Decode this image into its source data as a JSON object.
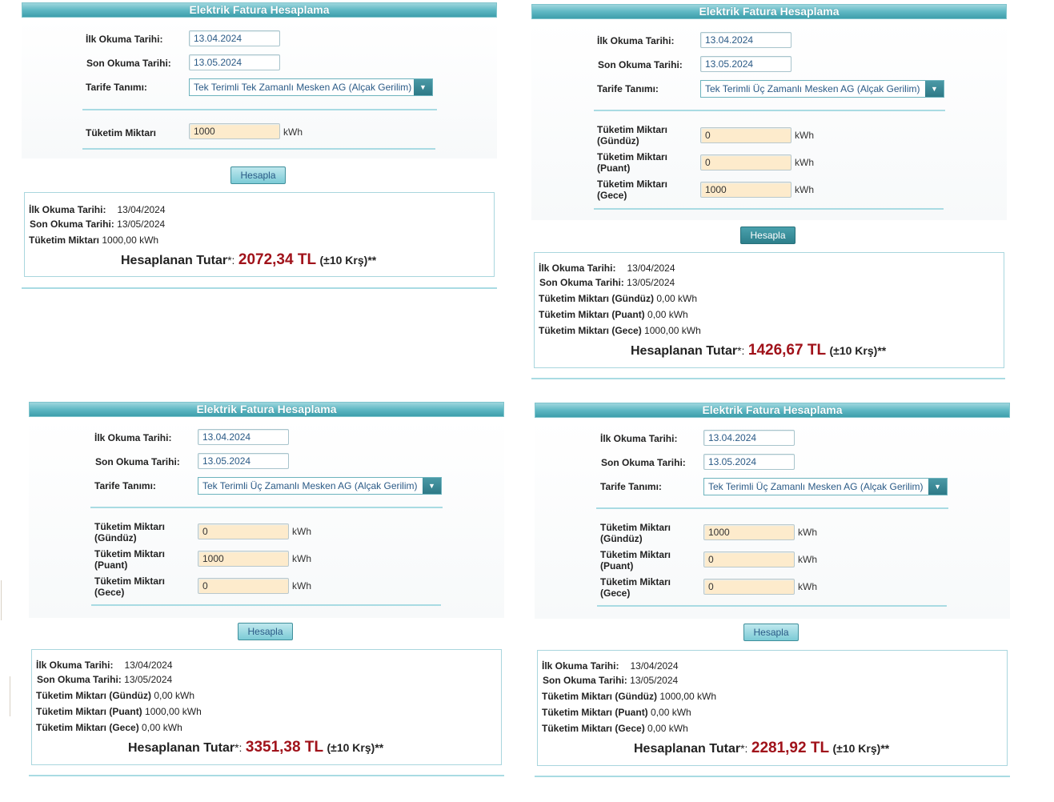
{
  "panels": [
    {
      "title": "Elektrik Fatura Hesaplama",
      "first_read_label": "İlk Okuma Tarihi:",
      "first_read_value": "13.04.2024",
      "last_read_label": "Son Okuma Tarihi:",
      "last_read_value": "13.05.2024",
      "tariff_label": "Tarife Tanımı:",
      "tariff_value": "Tek Terimli Tek Zamanlı Mesken AG (Alçak Gerilim)",
      "cons_label": "Tüketim Miktarı",
      "cons_value": "1000",
      "unit": "kWh",
      "button_label": "Hesapla",
      "r_first_label": "İlk Okuma Tarihi:",
      "r_first_value": "13/04/2024",
      "r_last_label": "Son Okuma Tarihi:",
      "r_last_value": "13/05/2024",
      "r_cons_label": "Tüketim Miktarı",
      "r_cons_value": "1000,00 kWh",
      "total_label": "Hesaplanan Tutar",
      "total_star": "*:",
      "total_amount": "2072,34 TL",
      "total_note": "(±10 Krş)**"
    },
    {
      "title": "Elektrik Fatura Hesaplama",
      "first_read_label": "İlk Okuma Tarihi:",
      "first_read_value": "13.04.2024",
      "last_read_label": "Son Okuma Tarihi:",
      "last_read_value": "13.05.2024",
      "tariff_label": "Tarife Tanımı:",
      "tariff_value": "Tek Terimli Üç Zamanlı Mesken AG (Alçak Gerilim)",
      "cons_day_label": "Tüketim Miktarı (Gündüz)",
      "cons_day_value": "0",
      "cons_peak_label": "Tüketim Miktarı (Puant)",
      "cons_peak_value": "0",
      "cons_night_label": "Tüketim Miktarı (Gece)",
      "cons_night_value": "1000",
      "unit": "kWh",
      "button_label": "Hesapla",
      "r_first_label": "İlk Okuma Tarihi:",
      "r_first_value": "13/04/2024",
      "r_last_label": "Son Okuma Tarihi:",
      "r_last_value": "13/05/2024",
      "r_day_label": "Tüketim Miktarı (Gündüz)",
      "r_day_value": "0,00 kWh",
      "r_peak_label": "Tüketim Miktarı (Puant)",
      "r_peak_value": "0,00 kWh",
      "r_night_label": "Tüketim Miktarı (Gece)",
      "r_night_value": "1000,00 kWh",
      "total_label": "Hesaplanan Tutar",
      "total_star": "*:",
      "total_amount": "1426,67 TL",
      "total_note": "(±10 Krş)**"
    },
    {
      "title": "Elektrik Fatura Hesaplama",
      "first_read_label": "İlk Okuma Tarihi:",
      "first_read_value": "13.04.2024",
      "last_read_label": "Son Okuma Tarihi:",
      "last_read_value": "13.05.2024",
      "tariff_label": "Tarife Tanımı:",
      "tariff_value": "Tek Terimli Üç Zamanlı Mesken AG (Alçak Gerilim)",
      "cons_day_label": "Tüketim Miktarı (Gündüz)",
      "cons_day_value": "0",
      "cons_peak_label": "Tüketim Miktarı (Puant)",
      "cons_peak_value": "1000",
      "cons_night_label": "Tüketim Miktarı (Gece)",
      "cons_night_value": "0",
      "unit": "kWh",
      "button_label": "Hesapla",
      "r_first_label": "İlk Okuma Tarihi:",
      "r_first_value": "13/04/2024",
      "r_last_label": "Son Okuma Tarihi:",
      "r_last_value": "13/05/2024",
      "r_day_label": "Tüketim Miktarı (Gündüz)",
      "r_day_value": "0,00 kWh",
      "r_peak_label": "Tüketim Miktarı (Puant)",
      "r_peak_value": "1000,00 kWh",
      "r_night_label": "Tüketim Miktarı (Gece)",
      "r_night_value": "0,00 kWh",
      "total_label": "Hesaplanan Tutar",
      "total_star": "*:",
      "total_amount": "3351,38 TL",
      "total_note": "(±10 Krş)**"
    },
    {
      "title": "Elektrik Fatura Hesaplama",
      "first_read_label": "İlk Okuma Tarihi:",
      "first_read_value": "13.04.2024",
      "last_read_label": "Son Okuma Tarihi:",
      "last_read_value": "13.05.2024",
      "tariff_label": "Tarife Tanımı:",
      "tariff_value": "Tek Terimli Üç Zamanlı Mesken AG (Alçak Gerilim)",
      "cons_day_label": "Tüketim Miktarı (Gündüz)",
      "cons_day_value": "1000",
      "cons_peak_label": "Tüketim Miktarı (Puant)",
      "cons_peak_value": "0",
      "cons_night_label": "Tüketim Miktarı (Gece)",
      "cons_night_value": "0",
      "unit": "kWh",
      "button_label": "Hesapla",
      "r_first_label": "İlk Okuma Tarihi:",
      "r_first_value": "13/04/2024",
      "r_last_label": "Son Okuma Tarihi:",
      "r_last_value": "13/05/2024",
      "r_day_label": "Tüketim Miktarı (Gündüz)",
      "r_day_value": "1000,00 kWh",
      "r_peak_label": "Tüketim Miktarı (Puant)",
      "r_peak_value": "0,00 kWh",
      "r_night_label": "Tüketim Miktarı (Gece)",
      "r_night_value": "0,00 kWh",
      "total_label": "Hesaplanan Tutar",
      "total_star": "*:",
      "total_amount": "2281,92 TL",
      "total_note": "(±10 Krş)**"
    }
  ],
  "colors": {
    "header": "#5fb8c4",
    "amount": "#a0121a",
    "input_bg": "#fdebcc",
    "rule": "#a9dbe3"
  },
  "icons": {
    "dropdown": "chevron-down-icon"
  }
}
